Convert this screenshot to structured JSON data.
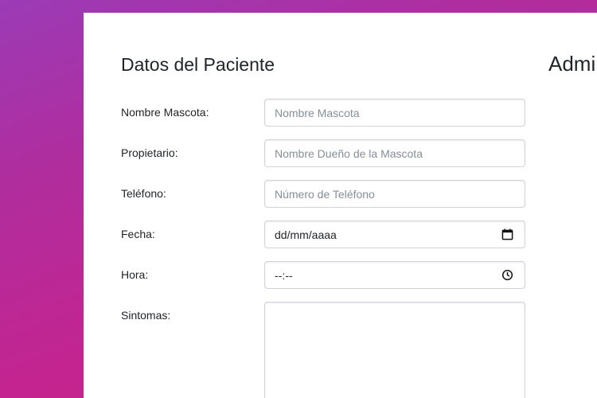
{
  "form": {
    "title": "Datos del Paciente",
    "fields": [
      {
        "label": "Nombre Mascota:",
        "placeholder": "Nombre Mascota"
      },
      {
        "label": "Propietario:",
        "placeholder": "Nombre Dueño de la Mascota"
      },
      {
        "label": "Teléfono:",
        "placeholder": "Número de Teléfono"
      },
      {
        "label": "Fecha:",
        "value": "dd/mm/aaaa",
        "icon": "calendar-icon"
      },
      {
        "label": "Hora:",
        "value": "--:--",
        "icon": "clock-icon"
      },
      {
        "label": "Sintomas:"
      }
    ]
  },
  "right_panel": {
    "title_partial": "Admi"
  }
}
